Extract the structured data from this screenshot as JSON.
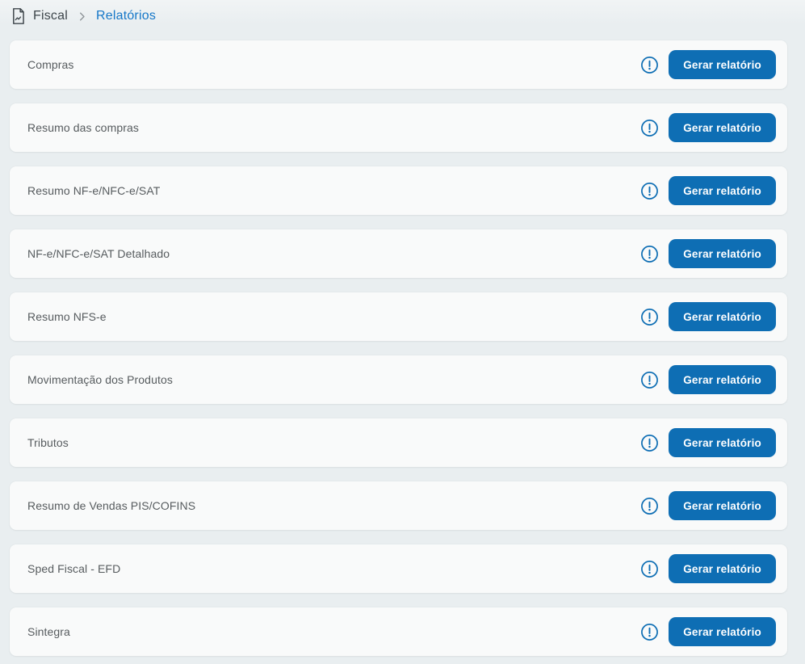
{
  "breadcrumb": {
    "icon": "report-file-icon",
    "separator_icon": "chevron-right-icon",
    "items": [
      {
        "label": "Fiscal"
      },
      {
        "label": "Relatórios"
      }
    ]
  },
  "actions": {
    "generate_label": "Gerar relatório",
    "info_icon": "exclamation-circle-icon"
  },
  "reports": [
    {
      "title": "Compras"
    },
    {
      "title": "Resumo das compras"
    },
    {
      "title": "Resumo NF-e/NFC-e/SAT"
    },
    {
      "title": "NF-e/NFC-e/SAT Detalhado"
    },
    {
      "title": "Resumo NFS-e"
    },
    {
      "title": "Movimentação dos Produtos"
    },
    {
      "title": "Tributos"
    },
    {
      "title": "Resumo de Vendas PIS/COFINS"
    },
    {
      "title": "Sped Fiscal - EFD"
    },
    {
      "title": "Sintegra"
    }
  ],
  "colors": {
    "accent_blue": "#0e6eb4",
    "link_blue": "#1577c8",
    "page_bg": "#e9eef0",
    "card_bg": "#f9fafa",
    "title_text": "#565b5e"
  }
}
